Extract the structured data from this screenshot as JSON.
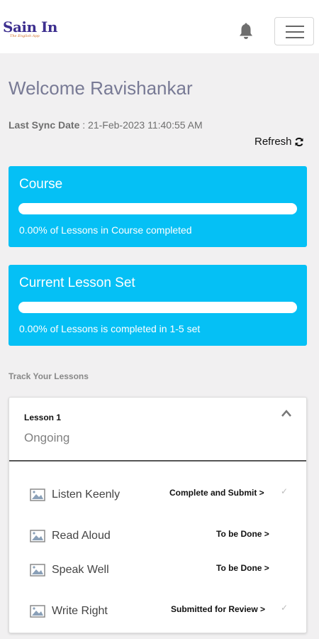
{
  "header": {
    "logo_text": "Sain In",
    "logo_tagline": "The English App",
    "bell_icon": "bell-icon",
    "menu_icon": "hamburger-menu-icon"
  },
  "welcome": "Welcome Ravishankar",
  "sync": {
    "label": "Last Sync Date",
    "value": " : 21-Feb-2023 11:40:55 AM"
  },
  "refresh_label": "Refresh",
  "course": {
    "title": "Course",
    "progress": 0,
    "text": "0.00% of Lessons in Course completed"
  },
  "lesson_set": {
    "title": "Current Lesson Set",
    "progress": 0,
    "text": "0.00% of Lessons is completed in 1-5 set"
  },
  "track_title": "Track Your Lessons",
  "lesson": {
    "title": "Lesson 1",
    "status": "Ongoing",
    "items": [
      {
        "label": "Listen Keenly",
        "action": "Complete and Submit >",
        "checked": true
      },
      {
        "label": "Read Aloud",
        "action": "To be Done >",
        "checked": false
      },
      {
        "label": "Speak Well",
        "action": "To be Done >",
        "checked": false
      },
      {
        "label": "Write Right",
        "action": "Submitted for Review >",
        "checked": true
      }
    ]
  },
  "colors": {
    "card_blue": "#05c0f5",
    "welcome_text": "#787a95",
    "logo_purple": "#3d2f8f",
    "logo_orange": "#d06a22"
  }
}
